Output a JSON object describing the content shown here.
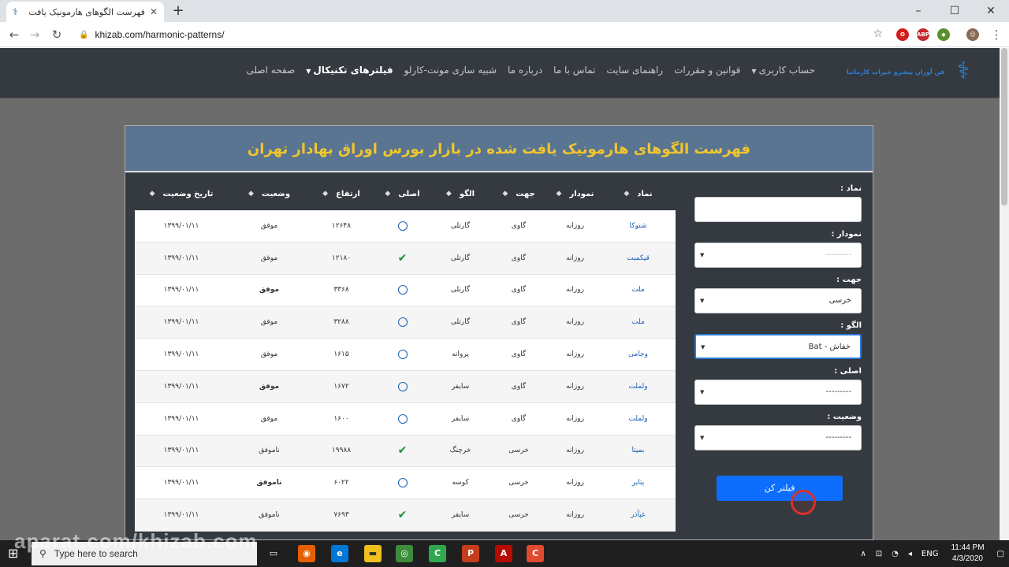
{
  "browser": {
    "tab_title": "فهرست الگوهای هارمونیک یافت ش",
    "url": "khizab.com/harmonic-patterns/"
  },
  "site": {
    "brand": "فن آوران پیشرو خیزاب کارمانیا",
    "menu": [
      {
        "label": "صفحه اصلی",
        "active": false
      },
      {
        "label": "فیلترهای تکنیکال",
        "active": true,
        "dropdown": true
      },
      {
        "label": "شبیه سازی مونت-کارلو",
        "active": false
      },
      {
        "label": "درباره ما",
        "active": false
      },
      {
        "label": "تماس با ما",
        "active": false
      },
      {
        "label": "راهنمای سایت",
        "active": false
      },
      {
        "label": "قوانین و مقررات",
        "active": false
      },
      {
        "label": "حساب کاربری",
        "active": false,
        "dropdown": true
      }
    ]
  },
  "card": {
    "title": "فهرست الگوهای هارمونیک یافت شده در بازار بورس اوراق بهادار تهران"
  },
  "filters": {
    "symbol_label": "نماد :",
    "symbol_value": "",
    "timeframe_label": "نمودار :",
    "timeframe_value": "---------",
    "direction_label": "جهت :",
    "direction_value": "خرسی",
    "pattern_label": "الگو :",
    "pattern_value": "خفاش - Bat",
    "original_label": "اصلی :",
    "original_value": "---------",
    "status_label": "وضعیت :",
    "status_value": "---------",
    "submit_label": "فیلتر کن"
  },
  "table": {
    "headers": {
      "symbol": "نماد",
      "timeframe": "نمودار",
      "direction": "جهت",
      "pattern": "الگو",
      "original": "اصلی",
      "height": "ارتفاع",
      "status": "وضعیت",
      "date": "تاریخ وضعیت"
    },
    "rows": [
      {
        "symbol": "شتوکا",
        "timeframe": "روزانه",
        "direction": "گاوی",
        "pattern": "گارتلی",
        "original": "circle",
        "height": "۱۲۶۴۸",
        "status": "موفق",
        "date": "۱۳۹۹/۰۱/۱۱",
        "bold_status": false
      },
      {
        "symbol": "قپکمبت",
        "timeframe": "روزانه",
        "direction": "گاوی",
        "pattern": "گارتلی",
        "original": "check",
        "height": "۱۲۱۸۰",
        "status": "موفق",
        "date": "۱۳۹۹/۰۱/۱۱",
        "bold_status": false
      },
      {
        "symbol": "ملت",
        "timeframe": "روزانه",
        "direction": "گاوی",
        "pattern": "گارتلی",
        "original": "circle",
        "height": "۳۳۶۸",
        "status": "موفق",
        "date": "۱۳۹۹/۰۱/۱۱",
        "bold_status": true
      },
      {
        "symbol": "ملت",
        "timeframe": "روزانه",
        "direction": "گاوی",
        "pattern": "گارتلی",
        "original": "circle",
        "height": "۳۲۸۸",
        "status": "موفق",
        "date": "۱۳۹۹/۰۱/۱۱",
        "bold_status": false
      },
      {
        "symbol": "وجامی",
        "timeframe": "روزانه",
        "direction": "گاوی",
        "pattern": "پروانه",
        "original": "circle",
        "height": "۱۶۱۵",
        "status": "موفق",
        "date": "۱۳۹۹/۰۱/۱۱",
        "bold_status": false
      },
      {
        "symbol": "ولملت",
        "timeframe": "روزانه",
        "direction": "گاوی",
        "pattern": "سایفر",
        "original": "circle",
        "height": "۱۶۷۲",
        "status": "موفق",
        "date": "۱۳۹۹/۰۱/۱۱",
        "bold_status": true
      },
      {
        "symbol": "ولملت",
        "timeframe": "روزانه",
        "direction": "گاوی",
        "pattern": "سایفر",
        "original": "circle",
        "height": "۱۶۰۰",
        "status": "موفق",
        "date": "۱۳۹۹/۰۱/۱۱",
        "bold_status": false
      },
      {
        "symbol": "بمیتا",
        "timeframe": "روزانه",
        "direction": "خرسی",
        "pattern": "خرچنگ",
        "original": "check",
        "height": "۱۹۹۸۸",
        "status": "ناموفق",
        "date": "۱۳۹۹/۰۱/۱۱",
        "bold_status": false
      },
      {
        "symbol": "پتایر",
        "timeframe": "روزانه",
        "direction": "خرسی",
        "pattern": "کوسه",
        "original": "circle",
        "height": "۶۰۲۲",
        "status": "ناموفق",
        "date": "۱۳۹۹/۰۱/۱۱",
        "bold_status": true
      },
      {
        "symbol": "غپآذر",
        "timeframe": "روزانه",
        "direction": "خرسی",
        "pattern": "سایفر",
        "original": "check",
        "height": "۷۶۹۳",
        "status": "ناموفق",
        "date": "۱۳۹۹/۰۱/۱۱",
        "bold_status": false
      }
    ]
  },
  "taskbar": {
    "search_placeholder": "Type here to search",
    "lang": "ENG",
    "time": "11:44 PM",
    "date": "4/3/2020"
  },
  "watermark": "aparat.com/khizab.com",
  "colors": {
    "nav_bg": "#343a40",
    "header_bg": "#5a7592",
    "title_yellow": "#f1c62e",
    "button_blue": "#0d6efd"
  }
}
